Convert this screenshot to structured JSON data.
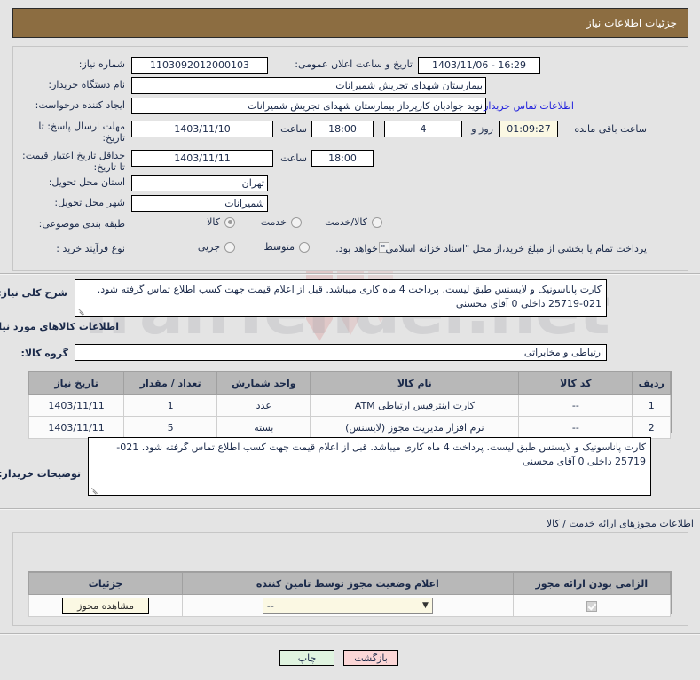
{
  "banner": {
    "title": "جزئیات اطلاعات نیاز"
  },
  "form": {
    "need_number_label": "شماره نیاز:",
    "need_number_value": "1103092012000103",
    "announce_label": "تاریخ و ساعت اعلان عمومی:",
    "announce_value": "16:29 - 1403/11/06",
    "buyer_org_label": "نام دستگاه خریدار:",
    "buyer_org_value": "بیمارستان شهدای تجریش شمیرانات",
    "creator_label": "ایجاد کننده درخواست:",
    "creator_value": "نوید جوادیان کارپرداز بیمارستان شهدای تجریش شمیرانات",
    "contact_link": "اطلاعات تماس خریدار",
    "deadline_label": "مهلت ارسال پاسخ: تا تاریخ:",
    "deadline_date": "1403/11/10",
    "hour_label": "ساعت",
    "deadline_time": "18:00",
    "days_value": "4",
    "days_unit": "روز و",
    "countdown_value": "01:09:27",
    "countdown_suffix": "ساعت باقی مانده",
    "price_validity_label": "حداقل تاریخ اعتبار قیمت: تا تاریخ:",
    "price_validity_date": "1403/11/11",
    "price_validity_time": "18:00",
    "province_label": "استان محل تحویل:",
    "province_value": "تهران",
    "city_label": "شهر محل تحویل:",
    "city_value": "شمیرانات",
    "classification_label": "طبقه بندی موضوعی:",
    "classification_options": [
      {
        "label": "کالا",
        "selected": true
      },
      {
        "label": "خدمت",
        "selected": false
      },
      {
        "label": "کالا/خدمت",
        "selected": false
      }
    ],
    "process_type_label": "نوع فرآیند خرید :",
    "process_type_options": [
      {
        "label": "جزیی",
        "selected": false
      },
      {
        "label": "متوسط",
        "selected": false
      }
    ],
    "treasury_checkbox_checked": false,
    "treasury_note": "پرداخت تمام یا بخشی از مبلغ خرید،از محل \"اسناد خزانه اسلامی\" خواهد بود."
  },
  "description": {
    "label": "شرح کلی نیاز:",
    "value": "کارت پاناسونیک و لایسنس طبق لیست. پرداخت 4 ماه کاری میباشد. قبل از اعلام قیمت جهت کسب اطلاع تماس گرفته شود. 021-25719  داخلی 0 آقای محسنی"
  },
  "goods_section": {
    "heading": "اطلاعات کالاهای مورد نیاز",
    "group_label": "گروه کالا:",
    "group_value": "ارتباطی و مخابراتی",
    "columns": [
      "ردیف",
      "کد کالا",
      "نام کالا",
      "واحد شمارش",
      "تعداد / مقدار",
      "تاریخ نیاز"
    ],
    "rows": [
      {
        "index": "1",
        "code": "--",
        "name": "کارت اینترفیس ارتباطی ATM",
        "unit": "عدد",
        "qty": "1",
        "date": "1403/11/11"
      },
      {
        "index": "2",
        "code": "--",
        "name": "نرم افزار مدیریت مجوز (لایسنس)",
        "unit": "بسته",
        "qty": "5",
        "date": "1403/11/11"
      }
    ]
  },
  "buyer_notes": {
    "label": "توضیحات خریدار:",
    "value": "کارت پاناسونیک و لایسنس طبق لیست. پرداخت 4 ماه کاری میباشد. قبل از اعلام قیمت جهت کسب اطلاع تماس گرفته شود. 021-25719  داخلی 0 آقای محسنی"
  },
  "permits": {
    "heading": "اطلاعات مجوزهای ارائه خدمت / کالا",
    "columns": [
      "الزامی بودن ارائه مجوز",
      "اعلام وضعیت مجوز توسط تامین کننده",
      "جزئیات"
    ],
    "row": {
      "required_checked": true,
      "status_value": "--",
      "details_button": "مشاهده مجوز"
    }
  },
  "footer": {
    "back_button": "بازگشت",
    "print_button": "چاپ"
  },
  "watermark": {
    "text": "IranTender.net"
  }
}
